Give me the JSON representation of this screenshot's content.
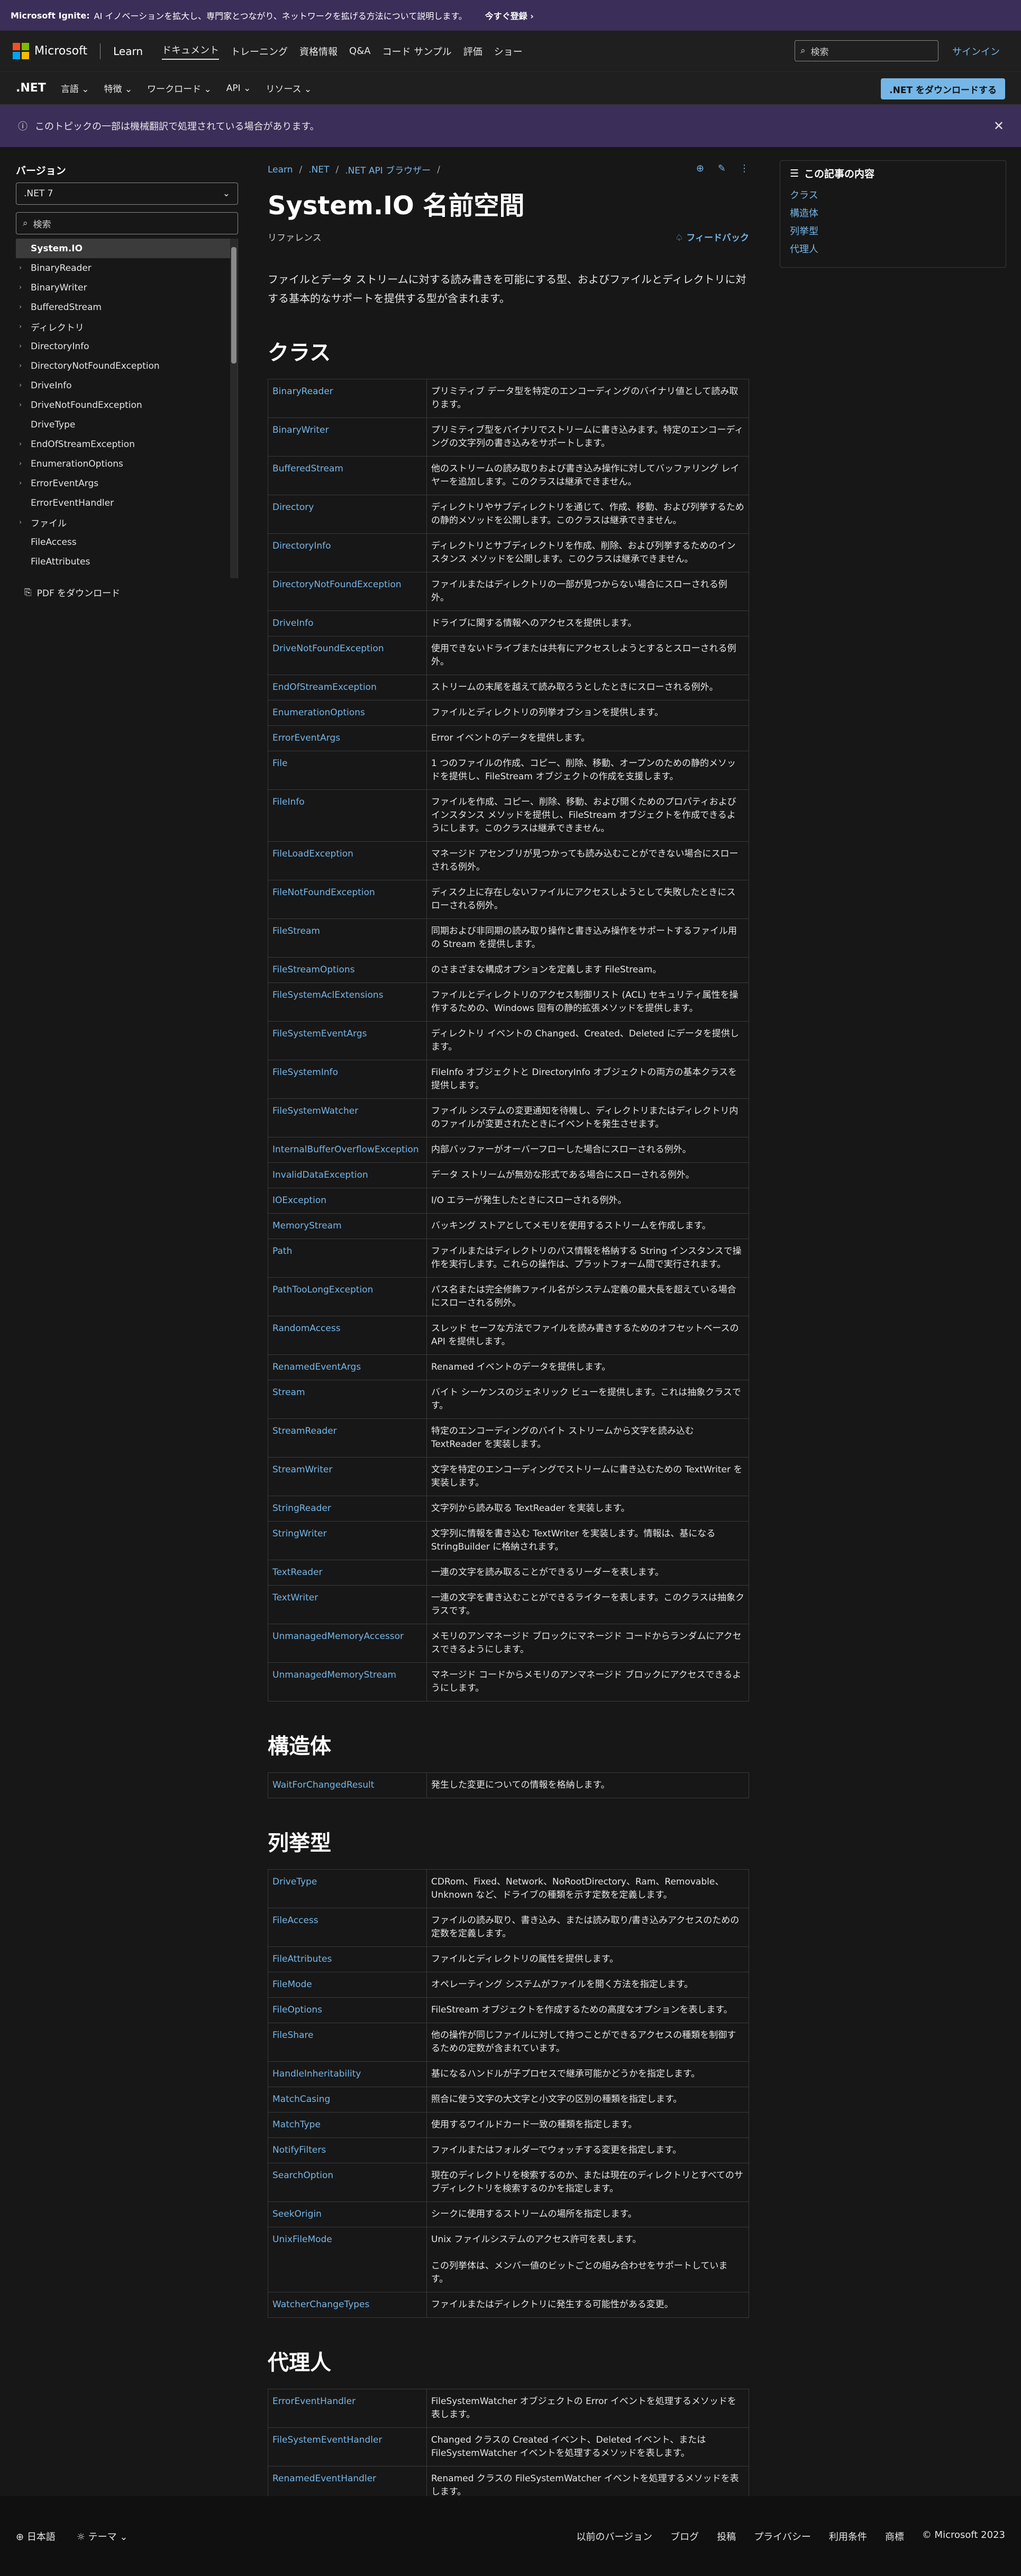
{
  "ignite": {
    "brand": "Microsoft Ignite:",
    "text": "AI イノベーションを拡大し、専門家とつながり、ネットワークを拡げる方法について説明します。",
    "cta": "今すぐ登録 ›",
    "bg": "#3b2e58"
  },
  "topnav": {
    "logo": "Microsoft",
    "site": "Learn",
    "items": [
      "ドキュメント",
      "トレーニング",
      "資格情報",
      "Q&A",
      "コード サンプル",
      "評価",
      "ショー"
    ],
    "search_placeholder": "検索",
    "signin": "サインイン"
  },
  "subnav": {
    "brand": ".NET",
    "items": [
      "言語",
      "特徴",
      "ワークロード",
      "API",
      "リソース"
    ],
    "download": ".NET をダウンロードする"
  },
  "notice": {
    "text": "このトピックの一部は機械翻訳で処理されている場合があります。"
  },
  "sidebar": {
    "title": "バージョン",
    "version": ".NET 7",
    "search_placeholder": "検索",
    "pdf": "PDF をダウンロード",
    "items": [
      {
        "label": "System.IO",
        "caret": "",
        "sel": true
      },
      {
        "label": "BinaryReader",
        "caret": "›"
      },
      {
        "label": "BinaryWriter",
        "caret": "›"
      },
      {
        "label": "BufferedStream",
        "caret": "›"
      },
      {
        "label": "ディレクトリ",
        "caret": "›"
      },
      {
        "label": "DirectoryInfo",
        "caret": "›"
      },
      {
        "label": "DirectoryNotFoundException",
        "caret": "›"
      },
      {
        "label": "DriveInfo",
        "caret": "›"
      },
      {
        "label": "DriveNotFoundException",
        "caret": "›"
      },
      {
        "label": "DriveType",
        "caret": ""
      },
      {
        "label": "EndOfStreamException",
        "caret": "›"
      },
      {
        "label": "EnumerationOptions",
        "caret": "›"
      },
      {
        "label": "ErrorEventArgs",
        "caret": "›"
      },
      {
        "label": "ErrorEventHandler",
        "caret": ""
      },
      {
        "label": "ファイル",
        "caret": "›"
      },
      {
        "label": "FileAccess",
        "caret": ""
      },
      {
        "label": "FileAttributes",
        "caret": ""
      }
    ]
  },
  "main": {
    "crumbs": [
      "Learn",
      "/",
      ".NET",
      "/",
      ".NET API ブラウザー",
      "/"
    ],
    "title": "System.IO 名前空間",
    "type": "リファレンス",
    "feedback": "フィードバック",
    "lead": "ファイルとデータ ストリームに対する読み書きを可能にする型、およびファイルとディレクトリに対する基本的なサポートを提供する型が含まれます。",
    "h_classes": "クラス",
    "h_structs": "構造体",
    "h_enums": "列挙型",
    "h_delegates": "代理人",
    "classes": [
      [
        "BinaryReader",
        "プリミティブ データ型を特定のエンコーディングのバイナリ値として読み取ります。"
      ],
      [
        "BinaryWriter",
        "プリミティブ型をバイナリでストリームに書き込みます。特定のエンコーディングの文字列の書き込みをサポートします。"
      ],
      [
        "BufferedStream",
        "他のストリームの読み取りおよび書き込み操作に対してバッファリング レイヤーを追加します。このクラスは継承できません。"
      ],
      [
        "Directory",
        "ディレクトリやサブディレクトリを通じて、作成、移動、および列挙するための静的メソッドを公開します。このクラスは継承できません。"
      ],
      [
        "DirectoryInfo",
        "ディレクトリとサブディレクトリを作成、削除、および列挙するためのインスタンス メソッドを公開します。このクラスは継承できません。"
      ],
      [
        "DirectoryNotFoundException",
        "ファイルまたはディレクトリの一部が見つからない場合にスローされる例外。"
      ],
      [
        "DriveInfo",
        "ドライブに関する情報へのアクセスを提供します。"
      ],
      [
        "DriveNotFoundException",
        "使用できないドライブまたは共有にアクセスしようとするとスローされる例外。"
      ],
      [
        "EndOfStreamException",
        "ストリームの末尾を越えて読み取ろうとしたときにスローされる例外。"
      ],
      [
        "EnumerationOptions",
        "ファイルとディレクトリの列挙オプションを提供します。"
      ],
      [
        "ErrorEventArgs",
        "Error イベントのデータを提供します。"
      ],
      [
        "File",
        "1 つのファイルの作成、コピー、削除、移動、オープンのための静的メソッドを提供し、FileStream オブジェクトの作成を支援します。"
      ],
      [
        "FileInfo",
        "ファイルを作成、コピー、削除、移動、および開くためのプロパティおよびインスタンス メソッドを提供し、FileStream オブジェクトを作成できるようにします。このクラスは継承できません。"
      ],
      [
        "FileLoadException",
        "マネージド アセンブリが見つかっても読み込むことができない場合にスローされる例外。"
      ],
      [
        "FileNotFoundException",
        "ディスク上に存在しないファイルにアクセスしようとして失敗したときにスローされる例外。"
      ],
      [
        "FileStream",
        "同期および非同期の読み取り操作と書き込み操作をサポートするファイル用の Stream を提供します。"
      ],
      [
        "FileStreamOptions",
        "のさまざまな構成オプションを定義します FileStream。"
      ],
      [
        "FileSystemAclExtensions",
        "ファイルとディレクトリのアクセス制御リスト (ACL) セキュリティ属性を操作するための、Windows 固有の静的拡張メソッドを提供します。"
      ],
      [
        "FileSystemEventArgs",
        "ディレクトリ イベントの Changed、Created、Deleted にデータを提供します。"
      ],
      [
        "FileSystemInfo",
        "FileInfo オブジェクトと DirectoryInfo オブジェクトの両方の基本クラスを提供します。"
      ],
      [
        "FileSystemWatcher",
        "ファイル システムの変更通知を待機し、ディレクトリまたはディレクトリ内のファイルが変更されたときにイベントを発生させます。"
      ],
      [
        "InternalBufferOverflowException",
        "内部バッファーがオーバーフローした場合にスローされる例外。"
      ],
      [
        "InvalidDataException",
        "データ ストリームが無効な形式である場合にスローされる例外。"
      ],
      [
        "IOException",
        "I/O エラーが発生したときにスローされる例外。"
      ],
      [
        "MemoryStream",
        "バッキング ストアとしてメモリを使用するストリームを作成します。"
      ],
      [
        "Path",
        "ファイルまたはディレクトリのパス情報を格納する String インスタンスで操作を実行します。これらの操作は、プラットフォーム間で実行されます。"
      ],
      [
        "PathTooLongException",
        "パス名または完全修飾ファイル名がシステム定義の最大長を超えている場合にスローされる例外。"
      ],
      [
        "RandomAccess",
        "スレッド セーフな方法でファイルを読み書きするためのオフセットベースの API を提供します。"
      ],
      [
        "RenamedEventArgs",
        "Renamed イベントのデータを提供します。"
      ],
      [
        "Stream",
        "バイト シーケンスのジェネリック ビューを提供します。これは抽象クラスです。"
      ],
      [
        "StreamReader",
        "特定のエンコーディングのバイト ストリームから文字を読み込む TextReader を実装します。"
      ],
      [
        "StreamWriter",
        "文字を特定のエンコーディングでストリームに書き込むための TextWriter を実装します。"
      ],
      [
        "StringReader",
        "文字列から読み取る TextReader を実装します。"
      ],
      [
        "StringWriter",
        "文字列に情報を書き込む TextWriter を実装します。情報は、基になる StringBuilder に格納されます。"
      ],
      [
        "TextReader",
        "一連の文字を読み取ることができるリーダーを表します。"
      ],
      [
        "TextWriter",
        "一連の文字を書き込むことができるライターを表します。このクラスは抽象クラスです。"
      ],
      [
        "UnmanagedMemoryAccessor",
        "メモリのアンマネージド ブロックにマネージド コードからランダムにアクセスできるようにします。"
      ],
      [
        "UnmanagedMemoryStream",
        "マネージド コードからメモリのアンマネージド ブロックにアクセスできるようにします。"
      ]
    ],
    "structs": [
      [
        "WaitForChangedResult",
        "発生した変更についての情報を格納します。"
      ]
    ],
    "enums": [
      [
        "DriveType",
        "CDRom、Fixed、Network、NoRootDirectory、Ram、Removable、Unknown など、ドライブの種類を示す定数を定義します。"
      ],
      [
        "FileAccess",
        "ファイルの読み取り、書き込み、または読み取り/書き込みアクセスのための定数を定義します。"
      ],
      [
        "FileAttributes",
        "ファイルとディレクトリの属性を提供します。"
      ],
      [
        "FileMode",
        "オペレーティング システムがファイルを開く方法を指定します。"
      ],
      [
        "FileOptions",
        "FileStream オブジェクトを作成するための高度なオプションを表します。"
      ],
      [
        "FileShare",
        "他の操作が同じファイルに対して持つことができるアクセスの種類を制御するための定数が含まれています。"
      ],
      [
        "HandleInheritability",
        "基になるハンドルが子プロセスで継承可能かどうかを指定します。"
      ],
      [
        "MatchCasing",
        "照合に使う文字の大文字と小文字の区別の種類を指定します。"
      ],
      [
        "MatchType",
        "使用するワイルドカード一致の種類を指定します。"
      ],
      [
        "NotifyFilters",
        "ファイルまたはフォルダーでウォッチする変更を指定します。"
      ],
      [
        "SearchOption",
        "現在のディレクトリを検索するのか、または現在のディレクトリとすべてのサブディレクトリを検索するのかを指定します。"
      ],
      [
        "SeekOrigin",
        "シークに使用するストリームの場所を指定します。"
      ],
      [
        "UnixFileMode",
        "Unix ファイルシステムのアクセス許可を表します。\n\nこの列挙体は、メンバー値のビットごとの組み合わせをサポートしています。"
      ],
      [
        "WatcherChangeTypes",
        "ファイルまたはディレクトリに発生する可能性がある変更。"
      ]
    ],
    "delegates": [
      [
        "ErrorEventHandler",
        "FileSystemWatcher オブジェクトの Error イベントを処理するメソッドを表します。"
      ],
      [
        "FileSystemEventHandler",
        "Changed クラスの Created イベント、Deleted イベント、または FileSystemWatcher イベントを処理するメソッドを表します。"
      ],
      [
        "RenamedEventHandler",
        "Renamed クラスの FileSystemWatcher イベントを処理するメソッドを表します。"
      ]
    ]
  },
  "rightcol": {
    "title": "この記事の内容",
    "links": [
      "クラス",
      "構造体",
      "列挙型",
      "代理人"
    ]
  },
  "footer": {
    "lang": "日本語",
    "theme": "テーマ",
    "links": [
      "以前のバージョン",
      "ブログ",
      "投稿",
      "プライバシー",
      "利用条件",
      "商標",
      "© Microsoft 2023"
    ]
  }
}
